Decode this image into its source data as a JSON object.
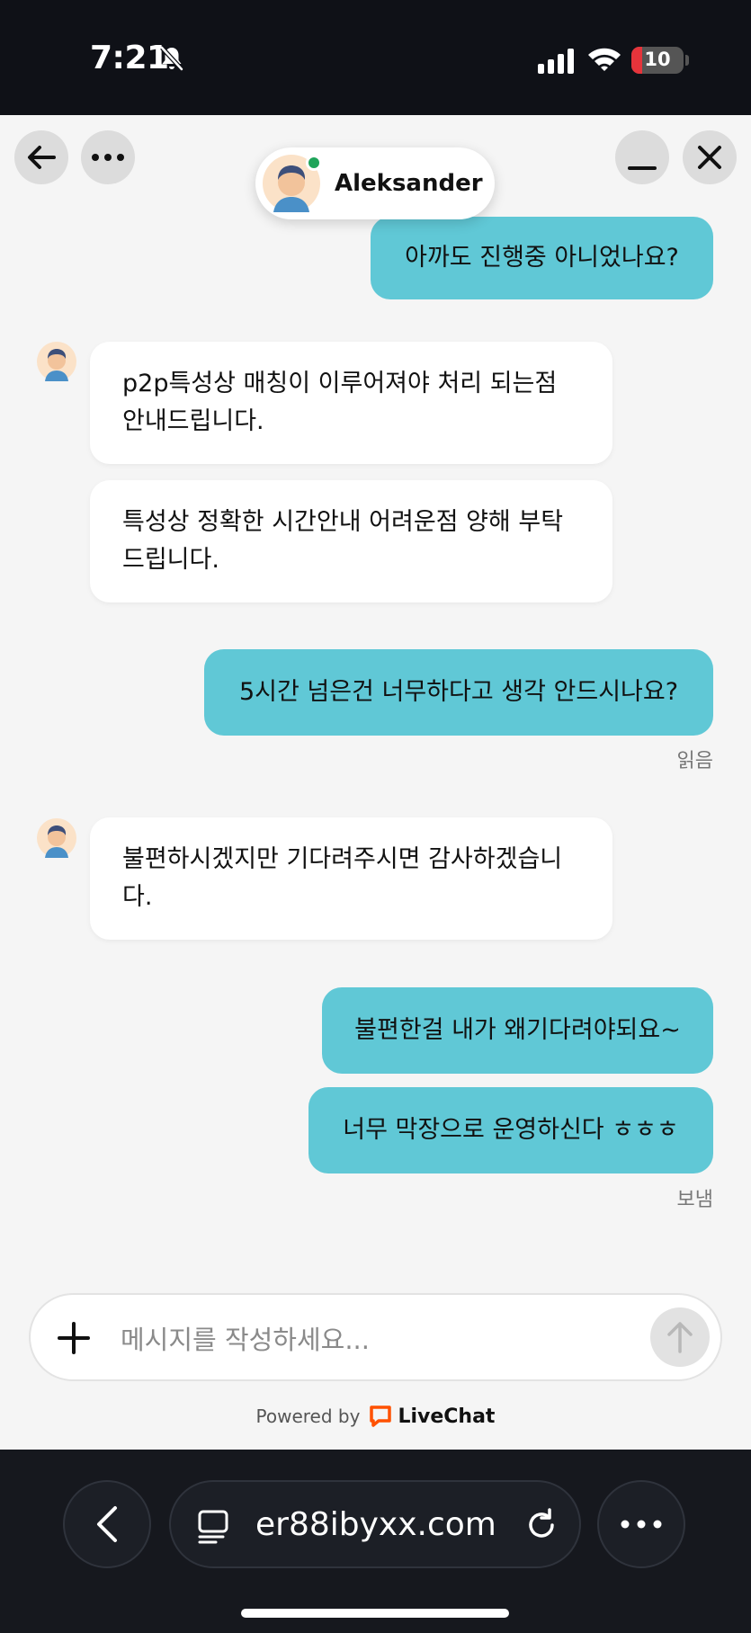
{
  "status_bar": {
    "time": "7:21",
    "battery": "10",
    "battery_color": "#e5343b"
  },
  "chat": {
    "agent_name": "Aleksander",
    "online_color": "#1fa45a",
    "accent": "#60c8d6",
    "messages": [
      {
        "from": "user",
        "text": "아까도 진행중 아니었나요?"
      },
      {
        "from": "agent",
        "text": "p2p특성상 매칭이 이루어져야 처리 되는점 안내드립니다."
      },
      {
        "from": "agent",
        "text": "특성상 정확한 시간안내 어려운점 양해 부탁드립니다."
      },
      {
        "from": "user",
        "text": "5시간 넘은건 너무하다고 생각 안드시나요?"
      },
      {
        "from": "agent",
        "text": "불편하시겠지만 기다려주시면 감사하겠습니다."
      },
      {
        "from": "user",
        "text": "불편한걸 내가 왜기다려야되요~"
      },
      {
        "from": "user",
        "text": "너무 막장으로 운영하신다 ㅎㅎㅎ"
      }
    ],
    "receipt_read": "읽음",
    "receipt_sent": "보냄"
  },
  "composer": {
    "placeholder": "메시지를 작성하세요..."
  },
  "footer": {
    "powered_by": "Powered by",
    "brand": "LiveChat",
    "brand_color": "#ff5100"
  },
  "browser": {
    "url": "er88ibyxx.com"
  }
}
